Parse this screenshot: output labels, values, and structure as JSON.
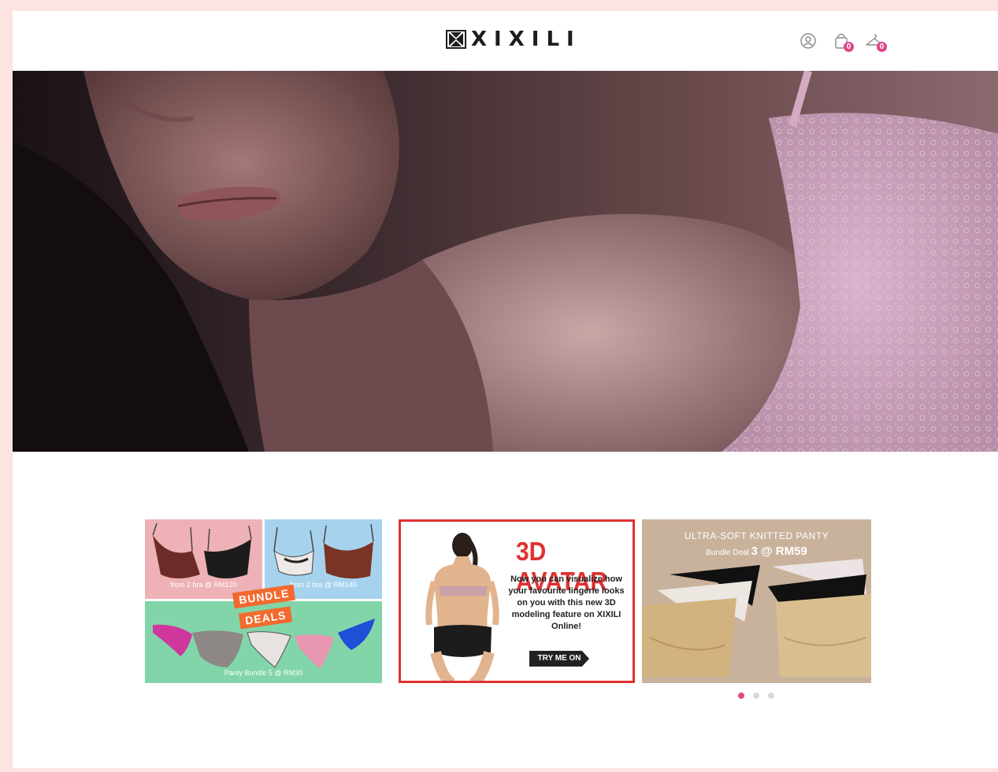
{
  "header": {
    "brand": "XIXILI",
    "cart_count": "0",
    "wishlist_count": "0"
  },
  "promos": {
    "bundle": {
      "bra_tile_1_caption": "from 2 bra @ RM120",
      "bra_tile_2_caption": "from 2 bra @ RM140",
      "tag_line_1": "BUNDLE",
      "tag_line_2": "DEALS",
      "panty_caption": "Panty Bundle 5 @ RM30"
    },
    "avatar": {
      "title": "3D AVATAR",
      "description": "Now you can visualize how your favourite lingerie looks on you with this new 3D modeling feature on XIXILI Online!",
      "button": "TRY ME ON"
    },
    "panty": {
      "title": "ULTRA-SOFT KNITTED PANTY",
      "sub_prefix": "Bundle Deal",
      "sub_deal": "3 @ RM59"
    }
  },
  "carousel": {
    "active_index": 1,
    "total": 3
  },
  "colors": {
    "accent": "#e0468a",
    "avatar_red": "#e03131",
    "page_border": "#fde3e2"
  }
}
